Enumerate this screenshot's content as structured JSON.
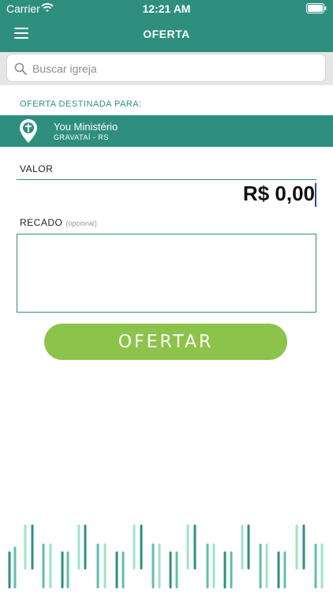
{
  "status_bar": {
    "carrier": "Carrier",
    "time": "12:21 AM"
  },
  "header": {
    "title": "OFERTA"
  },
  "search": {
    "placeholder": "Buscar igreja"
  },
  "offer": {
    "destination_label": "OFERTA DESTINADA PARA:",
    "church_name": "You Ministério",
    "church_location": "GRAVATAÍ - RS"
  },
  "form": {
    "valor_label": "VALOR",
    "amount": "R$ 0,00",
    "recado_label": "RECADO",
    "recado_optional": "(opcional)",
    "message_value": ""
  },
  "submit": {
    "label": "OFERTAR"
  },
  "colors": {
    "primary": "#2f8f7f",
    "button": "#8cc34a",
    "cursor": "#2a4a9c",
    "pattern": [
      "#2f8f7f",
      "#5fbfa7",
      "#9fe3c9"
    ]
  }
}
